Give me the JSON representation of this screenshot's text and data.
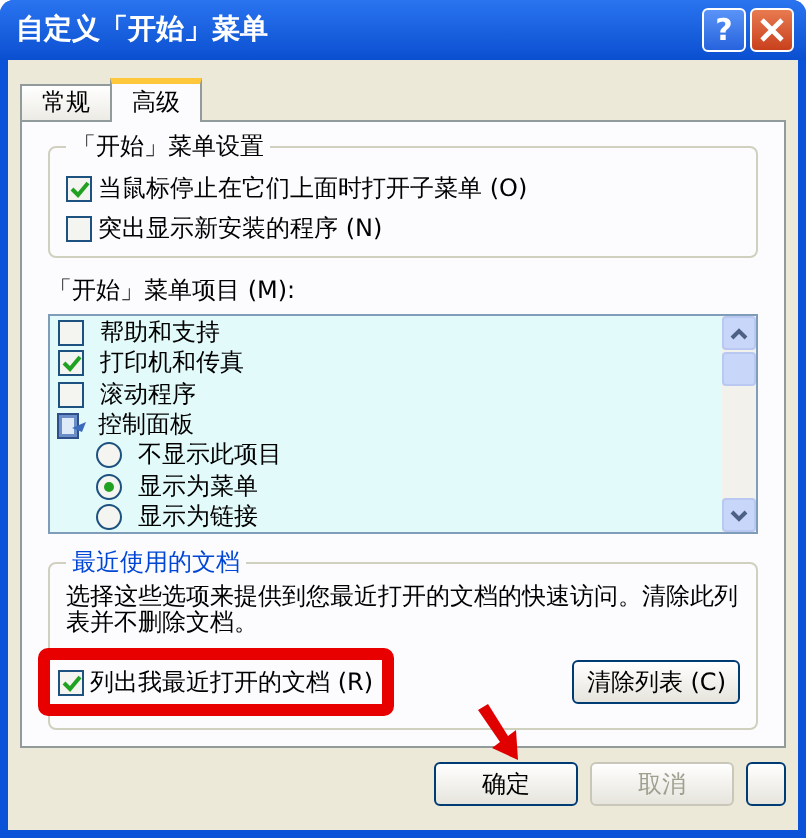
{
  "window": {
    "title": "自定义「开始」菜单",
    "help_button": "?"
  },
  "tabs": [
    {
      "label": "常规",
      "selected": false
    },
    {
      "label": "高级",
      "selected": true
    }
  ],
  "start_menu_settings": {
    "title": "「开始」菜单设置",
    "options": [
      {
        "label": "当鼠标停止在它们上面时打开子菜单 (O)",
        "checked": true
      },
      {
        "label": "突出显示新安装的程序 (N)",
        "checked": false
      }
    ]
  },
  "start_menu_items": {
    "label": "「开始」菜单项目 (M):",
    "items": [
      {
        "kind": "checkbox",
        "label": "帮助和支持",
        "checked": false
      },
      {
        "kind": "checkbox",
        "label": "打印机和传真",
        "checked": true
      },
      {
        "kind": "checkbox",
        "label": "滚动程序",
        "checked": false
      },
      {
        "kind": "folder",
        "label": "控制面板",
        "children": [
          {
            "kind": "radio",
            "label": "不显示此项目",
            "selected": false
          },
          {
            "kind": "radio",
            "label": "显示为菜单",
            "selected": true
          },
          {
            "kind": "radio",
            "label": "显示为链接",
            "selected": false
          }
        ]
      }
    ]
  },
  "recent_documents": {
    "title": "最近使用的文档",
    "description": "选择这些选项来提供到您最近打开的文档的快速访问。清除此列表并不删除文档。",
    "option": {
      "label": "列出我最近打开的文档 (R)",
      "checked": true,
      "highlighted": true
    },
    "clear_button": "清除列表 (C)"
  },
  "buttons": [
    {
      "label": "确定",
      "disabled": false,
      "pointed": true
    },
    {
      "label": "取消",
      "disabled": true,
      "pointed": false
    },
    {
      "disabled": false,
      "pointed": false
    }
  ]
}
